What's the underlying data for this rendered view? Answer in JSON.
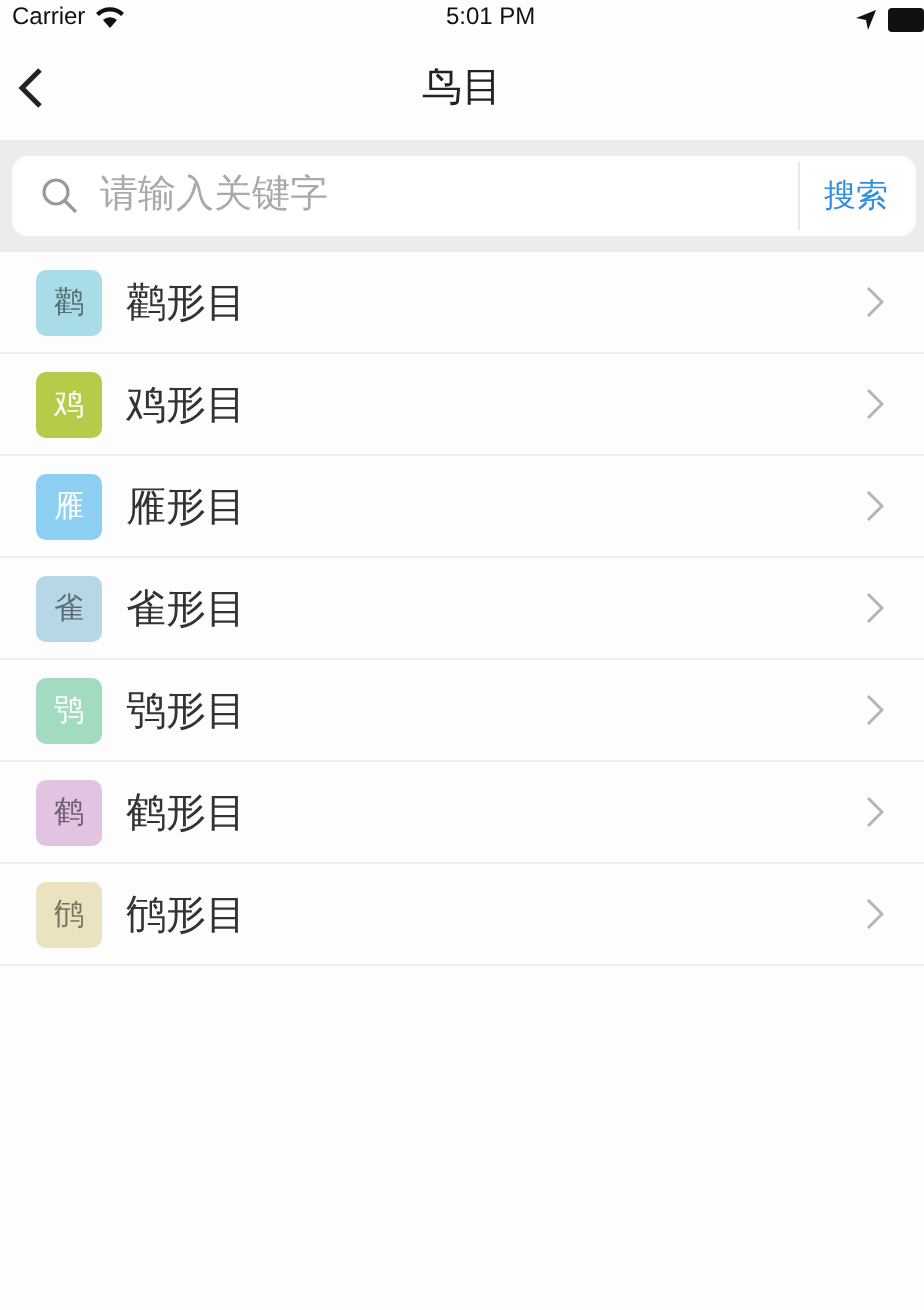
{
  "status_bar": {
    "carrier": "Carrier",
    "time": "5:01 PM"
  },
  "nav": {
    "title": "鸟目"
  },
  "search": {
    "placeholder": "请输入关键字",
    "button": "搜索"
  },
  "items": [
    {
      "badge": "鹳",
      "label": "鹳形目",
      "color": "#a8dce6"
    },
    {
      "badge": "鸡",
      "label": "鸡形目",
      "color": "#b5cc4a"
    },
    {
      "badge": "雁",
      "label": "雁形目",
      "color": "#8dcff0"
    },
    {
      "badge": "雀",
      "label": "雀形目",
      "color": "#b7d6e6"
    },
    {
      "badge": "鸮",
      "label": "鸮形目",
      "color": "#a3dbc1"
    },
    {
      "badge": "鹤",
      "label": "鹤形目",
      "color": "#e2c3e2"
    },
    {
      "badge": "鸻",
      "label": "鸻形目",
      "color": "#ebe3c0"
    }
  ]
}
